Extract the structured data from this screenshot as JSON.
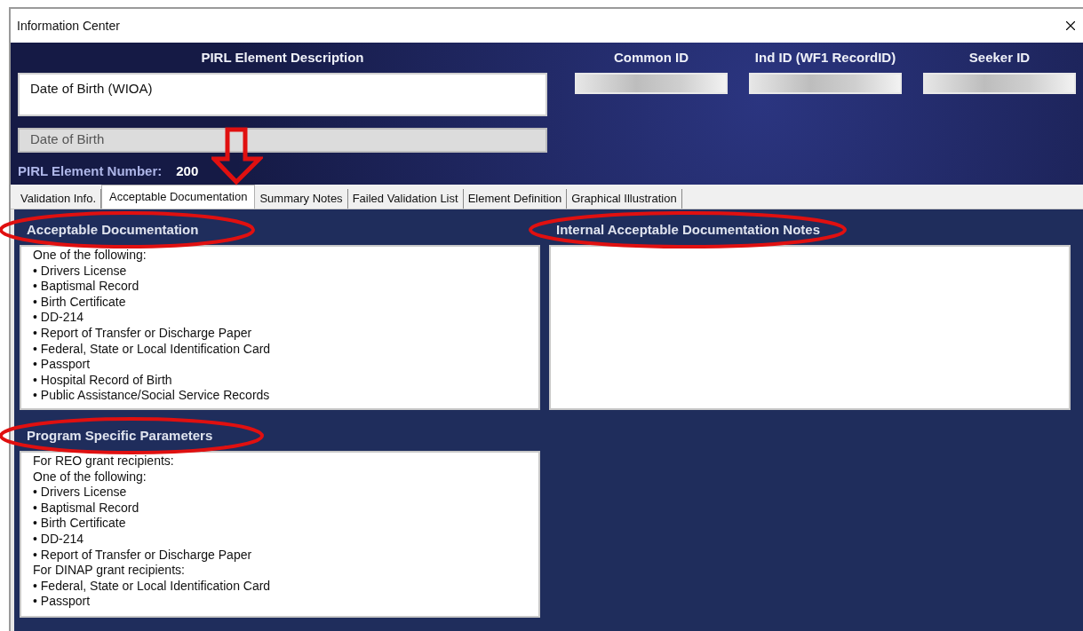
{
  "window": {
    "title": "Information Center"
  },
  "header": {
    "description_label": "PIRL Element Description",
    "description": "Date of Birth (WIOA)",
    "name": "Date of Birth",
    "element_number_label": "PIRL Element Number:",
    "element_number": "200"
  },
  "id_fields": [
    {
      "label": "Common ID"
    },
    {
      "label": "Ind ID (WF1 RecordID)"
    },
    {
      "label": "Seeker ID"
    }
  ],
  "tabs": [
    {
      "label": "Validation Info.",
      "selected": false
    },
    {
      "label": "Acceptable Documentation",
      "selected": true
    },
    {
      "label": "Summary Notes",
      "selected": false
    },
    {
      "label": "Failed Validation List",
      "selected": false
    },
    {
      "label": "Element Definition",
      "selected": false
    },
    {
      "label": "Graphical Illustration",
      "selected": false
    }
  ],
  "sections": [
    {
      "title": "Acceptable Documentation",
      "circled": true,
      "lines": [
        "One of the following:",
        "• Drivers License",
        "• Baptismal Record",
        "• Birth Certificate",
        "• DD-214",
        "• Report of Transfer or Discharge Paper",
        "• Federal, State or Local Identification Card",
        "• Passport",
        "• Hospital Record of Birth",
        "• Public Assistance/Social Service Records"
      ]
    },
    {
      "title": "Internal Acceptable Documentation Notes",
      "circled": true
    },
    {
      "title": "Program Specific Parameters",
      "circled": true,
      "lines": [
        "For REO grant recipients:",
        "One of the following:",
        "• Drivers License",
        "• Baptismal Record",
        "• Birth Certificate",
        "• DD-214",
        "• Report of Transfer or Discharge Paper",
        "For DINAP grant recipients:",
        "• Federal, State or Local Identification Card",
        "• Passport"
      ]
    }
  ]
}
